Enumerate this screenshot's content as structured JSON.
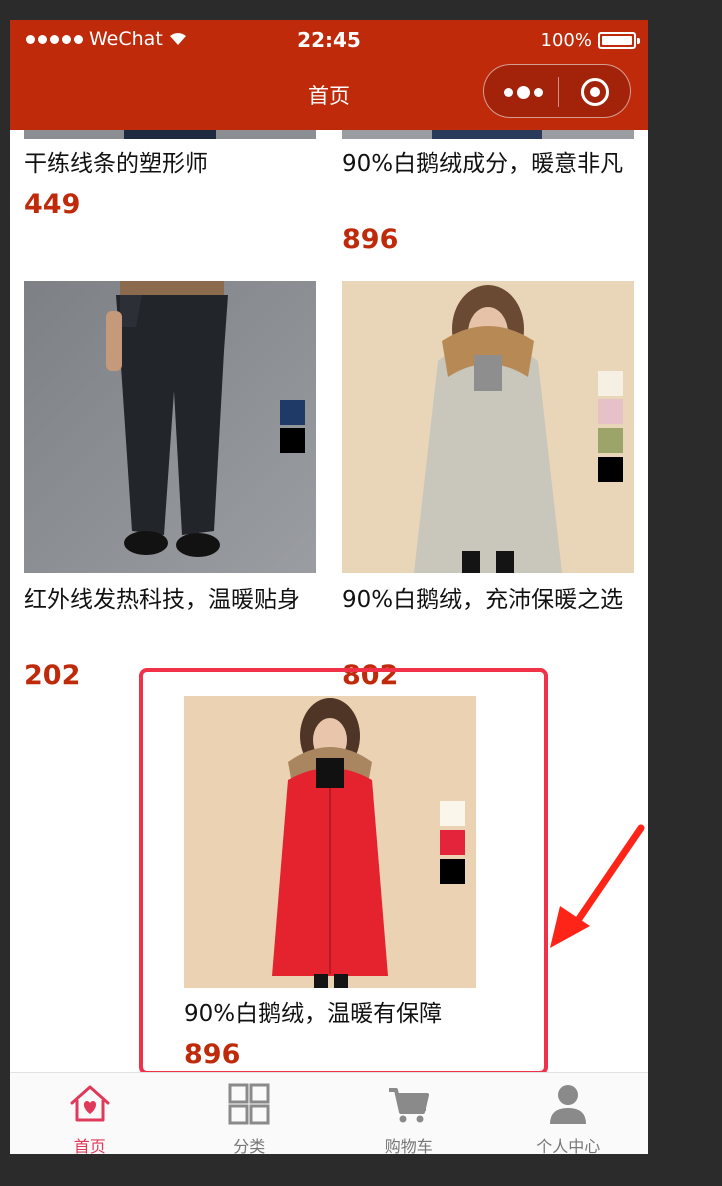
{
  "status_bar": {
    "carrier": "WeChat",
    "time": "22:45",
    "battery": "100%"
  },
  "nav": {
    "title": "首页"
  },
  "products": [
    {
      "title": "干练线条的塑形师",
      "price": "449"
    },
    {
      "title": "90%白鹅绒成分，暖意非凡",
      "price": "896"
    },
    {
      "title": "红外线发热科技，温暖贴身",
      "price": "202",
      "swatches": [
        "#1f3a66",
        "#000000"
      ]
    },
    {
      "title": "90%白鹅绒，充沛保暖之选",
      "price": "802",
      "swatches": [
        "#f6efe3",
        "#e7c1c8",
        "#9da469",
        "#000000"
      ]
    },
    {
      "title": "90%白鹅绒，温暖有保障",
      "price": "896",
      "swatches": [
        "#fbf6ec",
        "#e3243b",
        "#000000"
      ]
    }
  ],
  "tabs": [
    {
      "label": "首页",
      "icon": "home-icon",
      "active": true
    },
    {
      "label": "分类",
      "icon": "category-grid-icon"
    },
    {
      "label": "购物车",
      "icon": "cart-icon"
    },
    {
      "label": "个人中心",
      "icon": "profile-icon"
    }
  ],
  "colors": {
    "brand": "#bf2a0b",
    "price": "#bf2a0b",
    "highlight": "#f03148",
    "tab_active": "#e03a5b"
  }
}
